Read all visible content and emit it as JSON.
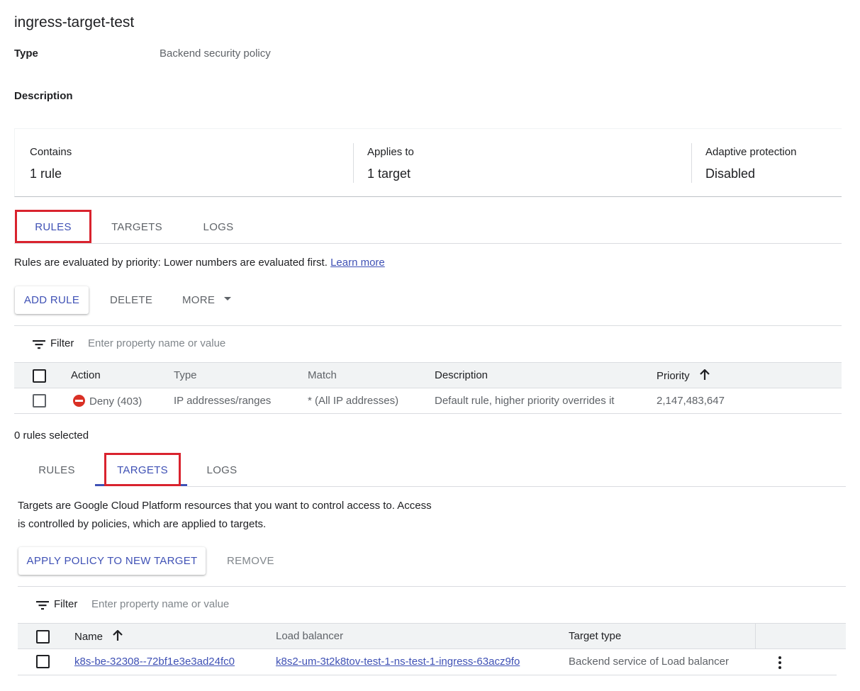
{
  "header": {
    "title": "ingress-target-test",
    "type_label": "Type",
    "type_value": "Backend security policy",
    "description_label": "Description"
  },
  "summary": [
    {
      "label": "Contains",
      "value": "1 rule"
    },
    {
      "label": "Applies to",
      "value": "1 target"
    },
    {
      "label": "Adaptive protection",
      "value": "Disabled"
    }
  ],
  "tabs_top": {
    "items": [
      "RULES",
      "TARGETS",
      "LOGS"
    ],
    "active": "RULES"
  },
  "rules": {
    "info_text": "Rules are evaluated by priority: Lower numbers are evaluated first.",
    "learn_more": "Learn more",
    "add_rule": "ADD RULE",
    "delete": "DELETE",
    "more": "MORE",
    "filter_label": "Filter",
    "filter_placeholder": "Enter property name or value",
    "columns": [
      "Action",
      "Type",
      "Match",
      "Description",
      "Priority"
    ],
    "rows": [
      {
        "action": "Deny (403)",
        "type": "IP addresses/ranges",
        "match": "* (All IP addresses)",
        "description": "Default rule, higher priority overrides it",
        "priority": "2,147,483,647"
      }
    ],
    "selected_text": "0 rules selected"
  },
  "tabs_bottom": {
    "items": [
      "RULES",
      "TARGETS",
      "LOGS"
    ],
    "active": "TARGETS"
  },
  "targets": {
    "info_line1": "Targets are Google Cloud Platform resources that you want to control access to. Access",
    "info_line2": "is controlled by policies, which are applied to targets.",
    "apply_button": "APPLY POLICY TO NEW TARGET",
    "remove_button": "REMOVE",
    "filter_label": "Filter",
    "filter_placeholder": "Enter property name or value",
    "columns": [
      "Name",
      "Load balancer",
      "Target type"
    ],
    "rows": [
      {
        "name": "k8s-be-32308--72bf1e3e3ad24fc0",
        "load_balancer": "k8s2-um-3t2k8tov-test-1-ns-test-1-ingress-63acz9fo",
        "target_type": "Backend service of Load balancer"
      }
    ]
  },
  "colors": {
    "accent": "#3f51b5",
    "highlight": "#d9232e",
    "deny": "#d93025"
  }
}
